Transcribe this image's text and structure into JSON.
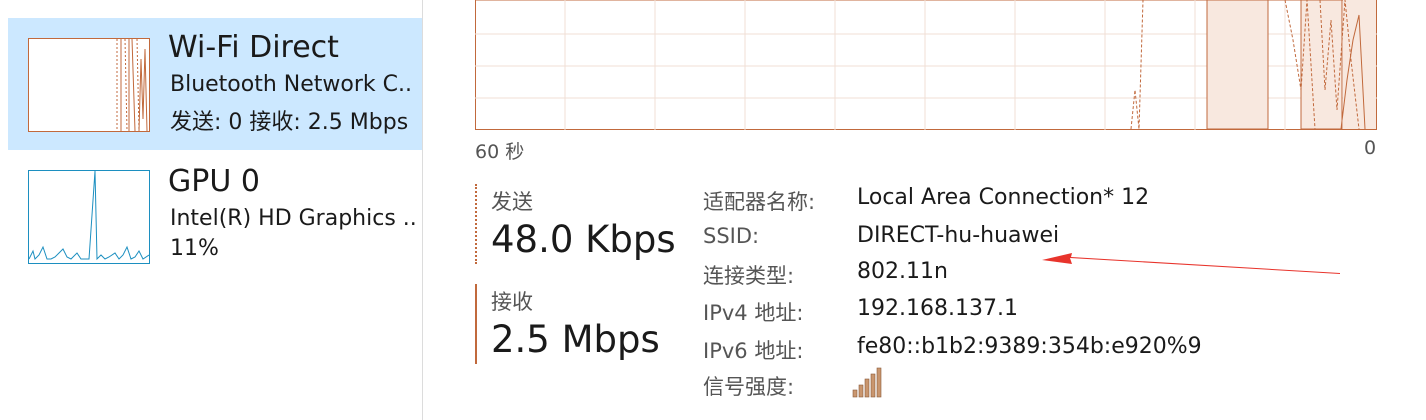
{
  "sidebar": {
    "items": [
      {
        "title": "Wi-Fi Direct",
        "line1": "Bluetooth Network C..",
        "line2": "发送: 0 接收: 2.5 Mbps",
        "selected": true
      },
      {
        "title": "GPU 0",
        "line1": "Intel(R) HD Graphics ..",
        "line2": "11%",
        "selected": false
      }
    ]
  },
  "graph": {
    "x_left_label": "60 秒",
    "x_right_label": "0"
  },
  "stats": {
    "send_label": "发送",
    "send_value": "48.0 Kbps",
    "receive_label": "接收",
    "receive_value": "2.5 Mbps"
  },
  "details": [
    {
      "label": "适配器名称:",
      "value": "Local Area Connection* 12"
    },
    {
      "label": "SSID:",
      "value": "DIRECT-hu-huawei"
    },
    {
      "label": "连接类型:",
      "value": "802.11n"
    },
    {
      "label": "IPv4 地址:",
      "value": "192.168.137.1"
    },
    {
      "label": "IPv6 地址:",
      "value": "fe80::b1b2:9389:354b:e920%9"
    },
    {
      "label": "信号强度:",
      "value": ""
    }
  ],
  "colors": {
    "accent": "#c1693c",
    "selection": "#cce8ff",
    "gpu": "#1c8fc0",
    "annotation": "#e8342c"
  },
  "icons": {
    "signal": "signal-strength-icon",
    "arrow": "annotation-arrow"
  }
}
